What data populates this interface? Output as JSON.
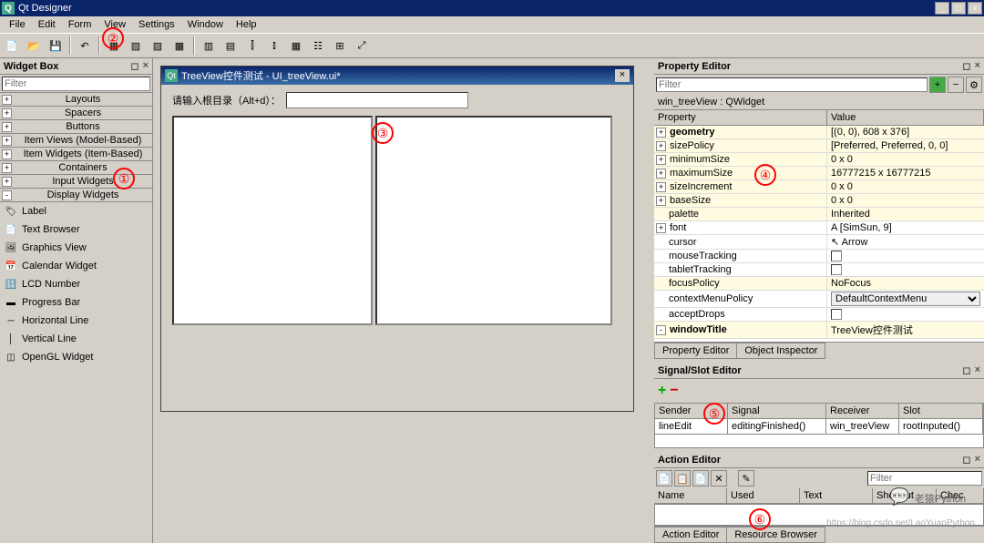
{
  "app_title": "Qt Designer",
  "menu": [
    "File",
    "Edit",
    "Form",
    "View",
    "Settings",
    "Window",
    "Help"
  ],
  "widget_box": {
    "title": "Widget Box",
    "filter_ph": "Filter",
    "categories": [
      {
        "label": "Layouts",
        "exp": "+"
      },
      {
        "label": "Spacers",
        "exp": "+"
      },
      {
        "label": "Buttons",
        "exp": "+"
      },
      {
        "label": "Item Views (Model-Based)",
        "exp": "+"
      },
      {
        "label": "Item Widgets (Item-Based)",
        "exp": "+"
      },
      {
        "label": "Containers",
        "exp": "+"
      },
      {
        "label": "Input Widgets",
        "exp": "+"
      },
      {
        "label": "Display Widgets",
        "exp": "-"
      }
    ],
    "display_items": [
      {
        "label": "Label"
      },
      {
        "label": "Text Browser"
      },
      {
        "label": "Graphics View"
      },
      {
        "label": "Calendar Widget"
      },
      {
        "label": "LCD Number"
      },
      {
        "label": "Progress Bar"
      },
      {
        "label": "Horizontal Line"
      },
      {
        "label": "Vertical Line"
      },
      {
        "label": "OpenGL Widget"
      }
    ]
  },
  "form": {
    "title": "TreeView控件测试 - UI_treeView.ui*",
    "label": "请输入根目录（Alt+d）："
  },
  "prop_editor": {
    "title": "Property Editor",
    "filter_ph": "Filter",
    "object": "win_treeView : QWidget",
    "hdr": {
      "p": "Property",
      "v": "Value"
    },
    "rows": [
      {
        "p": "geometry",
        "v": "[(0, 0), 608 x 376]",
        "pm": "+",
        "y": true,
        "bold": true
      },
      {
        "p": "sizePolicy",
        "v": "[Preferred, Preferred, 0, 0]",
        "pm": "+",
        "y": true
      },
      {
        "p": "minimumSize",
        "v": "0 x 0",
        "pm": "+",
        "y": true
      },
      {
        "p": "maximumSize",
        "v": "16777215 x 16777215",
        "pm": "+",
        "y": true
      },
      {
        "p": "sizeIncrement",
        "v": "0 x 0",
        "pm": "+",
        "y": true
      },
      {
        "p": "baseSize",
        "v": "0 x 0",
        "pm": "+",
        "y": true
      },
      {
        "p": "palette",
        "v": "Inherited",
        "y": true
      },
      {
        "p": "font",
        "v": "A  [SimSun, 9]",
        "pm": "+"
      },
      {
        "p": "cursor",
        "v": "Arrow",
        "cursor": true
      },
      {
        "p": "mouseTracking",
        "v": "",
        "chk": true
      },
      {
        "p": "tabletTracking",
        "v": "",
        "chk": true
      },
      {
        "p": "focusPolicy",
        "v": "NoFocus",
        "y": true
      },
      {
        "p": "contextMenuPolicy",
        "v": "DefaultContextMenu",
        "sel": true
      },
      {
        "p": "acceptDrops",
        "v": "",
        "chk": true
      },
      {
        "p": "windowTitle",
        "v": "TreeView控件测试",
        "pm": "-",
        "y": true,
        "bold": true
      }
    ],
    "tabs": [
      "Property Editor",
      "Object Inspector"
    ]
  },
  "signal": {
    "title": "Signal/Slot Editor",
    "hdr": {
      "s": "Sender",
      "sig": "Signal",
      "r": "Receiver",
      "sl": "Slot"
    },
    "row": {
      "s": "lineEdit",
      "sig": "editingFinished()",
      "r": "win_treeView",
      "sl": "rootInputed()"
    }
  },
  "action": {
    "title": "Action Editor",
    "filter_ph": "Filter",
    "hdr": [
      "Name",
      "Used",
      "Text",
      "Shortcut",
      "Chec"
    ],
    "tabs": [
      "Action Editor",
      "Resource Browser"
    ]
  },
  "watermark": "老猿Python",
  "url": "https://blog.csdn.net/LaoYuanPython"
}
